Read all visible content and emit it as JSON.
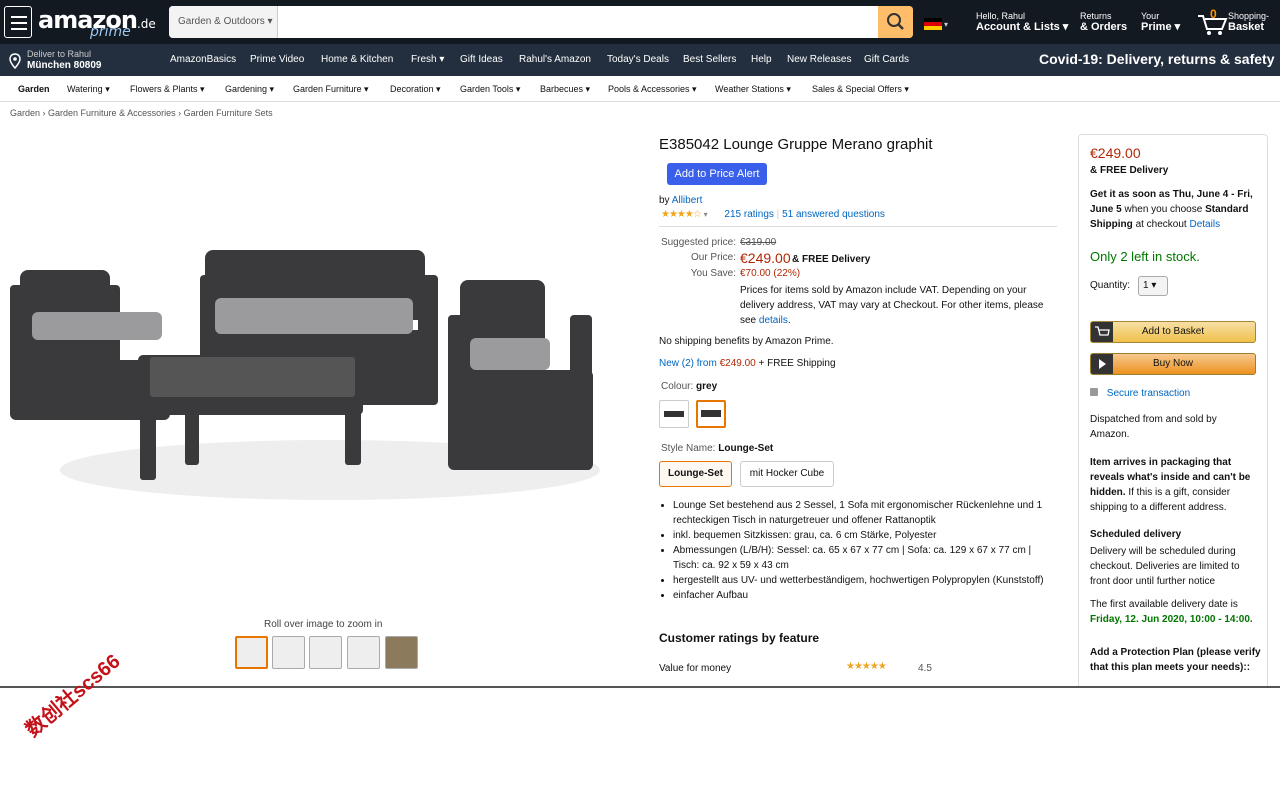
{
  "header": {
    "logo_text": "amazon",
    "logo_tld": ".de",
    "logo_prime": "prime",
    "search_category": "Garden & Outdoors",
    "search_placeholder": "",
    "account_greeting": "Hello, Rahul",
    "account_label": "Account & Lists",
    "returns_line1": "Returns",
    "returns_line2": "& Orders",
    "your_prime_line1": "Your",
    "your_prime_line2": "Prime",
    "basket_count": "0",
    "basket_line1": "Shopping-",
    "basket_line2": "Basket"
  },
  "nav2": {
    "deliver_line1": "Deliver to Rahul",
    "deliver_line2": "München 80809",
    "links": [
      "AmazonBasics",
      "Prime Video",
      "Home & Kitchen",
      "Fresh",
      "Gift Ideas",
      "Rahul's Amazon",
      "Today's Deals",
      "Best Sellers",
      "Help",
      "New Releases",
      "Gift Cards"
    ],
    "covid": "Covid-19: Delivery, returns & safety"
  },
  "nav3": {
    "categories": [
      "Garden",
      "Watering",
      "Flowers & Plants",
      "Gardening",
      "Garden Furniture",
      "Decoration",
      "Garden Tools",
      "Barbecues",
      "Pools & Accessories",
      "Weather Stations",
      "Sales & Special Offers"
    ]
  },
  "breadcrumb": [
    "Garden",
    "Garden Furniture & Accessories",
    "Garden Furniture Sets"
  ],
  "gallery": {
    "zoom_hint": "Roll over image to zoom in"
  },
  "product": {
    "title": "E385042 Lounge Gruppe Merano graphit",
    "price_alert_button": "Add to Price Alert",
    "by_label": "by",
    "brand": "Allibert",
    "rating_value": 4,
    "ratings_count": "215 ratings",
    "answered_questions": "51 answered questions",
    "suggested_label": "Suggested price:",
    "suggested_price": "€319.00",
    "our_price_label": "Our Price:",
    "our_price": "€249.00",
    "free_delivery": "& FREE Delivery",
    "you_save_label": "You Save:",
    "you_save": "€70.00 (22%)",
    "vat_note": "Prices for items sold by Amazon include VAT. Depending on your delivery address, VAT may vary at Checkout. For other items, please see",
    "vat_link": "details",
    "shipping_note": "No shipping benefits by Amazon Prime.",
    "new_offers_link": "New (2) from",
    "new_offers_price": "€249.00",
    "new_offers_suffix": "+ FREE Shipping",
    "colour_label": "Colour:",
    "colour_value": "grey",
    "style_label": "Style Name:",
    "style_value": "Lounge-Set",
    "styles": [
      "Lounge-Set",
      "mit Hocker Cube"
    ],
    "bullets": [
      "Lounge Set bestehend aus 2 Sessel, 1 Sofa mit ergonomischer Rückenlehne und 1 rechteckigen Tisch in naturgetreuer und offener Rattanoptik",
      "inkl. bequemen Sitzkissen: grau, ca. 6 cm Stärke, Polyester",
      "Abmessungen (L/B/H): Sessel: ca. 65 x 67 x 77 cm | Sofa: ca. 129 x 67 x 77 cm | Tisch: ca. 92 x 59 x 43 cm",
      "hergestellt aus UV- und wetterbeständigem, hochwertigen Polypropylen (Kunststoff)",
      "einfacher Aufbau"
    ],
    "ratings_feature_heading": "Customer ratings by feature",
    "feature_name": "Value for money",
    "feature_score": "4.5"
  },
  "buybox": {
    "price": "€249.00",
    "free_delivery": "& FREE Delivery",
    "delivery_pre": "Get it as soon as Thu, June 4 - Fri, June 5",
    "delivery_mid": "when you choose",
    "delivery_bold": "Standard Shipping",
    "delivery_post": "at checkout",
    "details_link": "Details",
    "stock": "Only 2 left in stock.",
    "quantity_label": "Quantity:",
    "quantity_value": "1",
    "add_to_basket": "Add to Basket",
    "buy_now": "Buy Now",
    "secure": "Secure transaction",
    "dispatched": "Dispatched from and sold by Amazon.",
    "packaging_bold": "Item arrives in packaging that reveals what's inside and can't be hidden.",
    "packaging_rest": "If this is a gift, consider shipping to a different address.",
    "scheduled_heading": "Scheduled delivery",
    "scheduled_text": "Delivery will be scheduled during checkout. Deliveries are limited to front door until further notice",
    "first_date_text": "The first available delivery date is",
    "first_date_value": "Friday, 12. Jun 2020, 10:00 - 14:00.",
    "protection": "Add a Protection Plan (please verify that this plan meets your needs)::"
  },
  "watermark": "数创社scs66",
  "colors": {
    "nav_dark": "#131921",
    "nav_mid": "#232f3e",
    "accent": "#febd69",
    "price": "#b12704",
    "stock": "#007600",
    "link": "#0066c0"
  }
}
